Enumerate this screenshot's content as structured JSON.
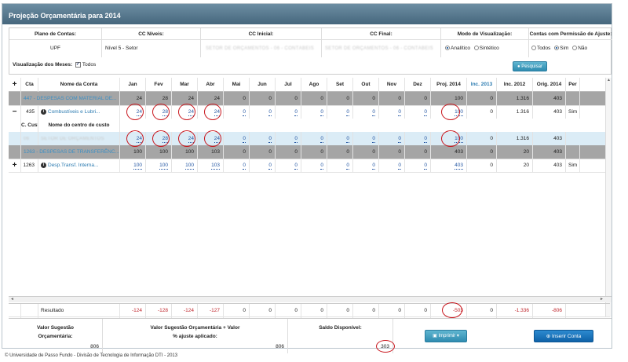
{
  "window": {
    "title": "Projeção Orçamentária para 2014"
  },
  "filters": {
    "plano_label": "Plano de Contas:",
    "plano_value": "UPF",
    "niveis_label": "CC Níveis:",
    "niveis_value": "Nível 5 - Setor",
    "inicial_label": "CC Inicial:",
    "inicial_value": "SETOR DE ORÇAMENTOS - 06 - CONTÁBEIS",
    "final_label": "CC Final:",
    "final_value": "SETOR DE ORÇAMENTOS - 06 - CONTÁBEIS",
    "modo_label": "Modo de Visualização:",
    "modo_options": [
      "Analítico",
      "Sintético"
    ],
    "modo_selected": "Analítico",
    "permissao_label": "Contas com Permissão de Ajuste:",
    "permissao_options": [
      "Todos",
      "Sim",
      "Não"
    ],
    "permissao_selected": "Sim",
    "meses_label": "Visualização dos Meses:",
    "meses_check": "✓",
    "meses_text": "Todos",
    "pesquisar": "Pesquisar"
  },
  "table": {
    "expand_all": "+",
    "headers": [
      "Cta",
      "Nome da Conta",
      "Jan",
      "Fev",
      "Mar",
      "Abr",
      "Mai",
      "Jun",
      "Jul",
      "Ago",
      "Set",
      "Out",
      "Nov",
      "Dez",
      "Proj. 2014",
      "Inc. 2013",
      "Inc. 2012",
      "Orig. 2014",
      "Per"
    ],
    "group1": {
      "name": "447 - DESPESAS COM MATERIAL DE...",
      "months": [
        "24",
        "28",
        "24",
        "24",
        "0",
        "0",
        "0",
        "0",
        "0",
        "0",
        "0",
        "0"
      ],
      "proj": "100",
      "inc2013": "0",
      "inc2012": "1.316",
      "orig": "403",
      "per": ""
    },
    "row1": {
      "toggle": "−",
      "cta": "435",
      "info": "i",
      "name": "Combustíveis e Lubri...",
      "months": [
        "24",
        "28",
        "24",
        "24",
        "0",
        "0",
        "0",
        "0",
        "0",
        "0",
        "0",
        "0"
      ],
      "proj": "100",
      "inc2013": "0",
      "inc2012": "1.316",
      "orig": "403",
      "per": "Sim"
    },
    "subheader": {
      "ccusto": "C. Custo",
      "nome": "Nome do centro de custo"
    },
    "subrow": {
      "code": "06",
      "name": "SETOR DE ORÇAMENTOS",
      "months": [
        "24",
        "28",
        "24",
        "24",
        "0",
        "0",
        "0",
        "0",
        "0",
        "0",
        "0",
        "0"
      ],
      "proj": "100",
      "inc2013": "0",
      "inc2012": "1.316",
      "orig": "403"
    },
    "group2": {
      "name": "1263 - DESPESAS DE TRANSFERÊNC...",
      "months": [
        "100",
        "100",
        "100",
        "103",
        "0",
        "0",
        "0",
        "0",
        "0",
        "0",
        "0",
        "0"
      ],
      "proj": "403",
      "inc2013": "0",
      "inc2012": "20",
      "orig": "403",
      "per": ""
    },
    "row2": {
      "toggle": "+",
      "cta": "1263",
      "info": "i",
      "name": "Desp.Transf. Interna...",
      "months": [
        "100",
        "100",
        "100",
        "103",
        "0",
        "0",
        "0",
        "0",
        "0",
        "0",
        "0",
        "0"
      ],
      "proj": "403",
      "inc2013": "0",
      "inc2012": "20",
      "orig": "403",
      "per": "Sim"
    },
    "resultado": {
      "label": "Resultado",
      "months": [
        "-124",
        "-128",
        "-124",
        "-127",
        "0",
        "0",
        "0",
        "0",
        "0",
        "0",
        "0",
        "0"
      ],
      "proj": "-503",
      "inc2013": "0",
      "inc2012": "-1.336",
      "orig": "-806"
    }
  },
  "summary": {
    "sugestao_label": "Valor Sugestão Orçamentária:",
    "sugestao_value": "806",
    "ajuste_label": "Valor Sugestão Orçamentária + Valor % ajuste aplicado:",
    "ajuste_value": "806",
    "saldo_label": "Saldo Disponível:",
    "saldo_value": "303",
    "imprimir": "Imprimir",
    "inserir": "Inserir Conta"
  },
  "footer": "© Universidade de Passo Fundo - Divisão de Tecnologia de Informação DTI - 2013"
}
